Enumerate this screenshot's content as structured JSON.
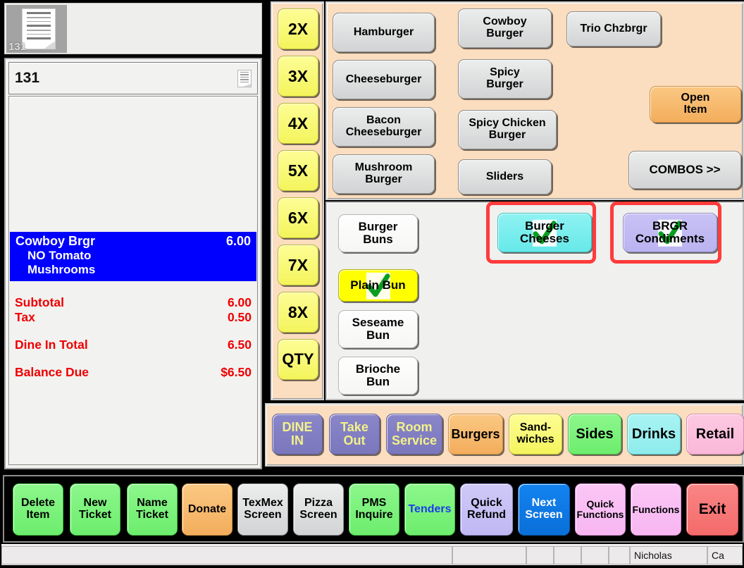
{
  "thumbnail": {
    "ticket_label": "131",
    "icon": "receipt-document-icon"
  },
  "ticket": {
    "number": "131",
    "icon": "receipt-document-icon",
    "line_items": [
      {
        "name": "Cowboy Brgr",
        "price": "6.00",
        "modifiers": [
          "NO Tomato",
          "Mushrooms"
        ]
      }
    ],
    "totals": [
      {
        "label": "Subtotal",
        "value": "6.00"
      },
      {
        "label": "Tax",
        "value": "0.50"
      },
      {
        "label": "Dine In Total",
        "value": "6.50"
      },
      {
        "label": "Balance Due",
        "value": "$6.50"
      }
    ]
  },
  "quantity_keys": [
    {
      "label": "2X"
    },
    {
      "label": "3X"
    },
    {
      "label": "4X"
    },
    {
      "label": "5X"
    },
    {
      "label": "6X"
    },
    {
      "label": "7X"
    },
    {
      "label": "8X"
    },
    {
      "label": "QTY"
    }
  ],
  "menu": {
    "column1": [
      {
        "label": "Hamburger"
      },
      {
        "label": "Cheeseburger"
      },
      {
        "label": "Bacon\nCheeseburger"
      },
      {
        "label": "Mushroom\nBurger"
      }
    ],
    "column2": [
      {
        "label": "Cowboy\nBurger"
      },
      {
        "label": "Spicy\nBurger"
      },
      {
        "label": "Spicy Chicken\nBurger"
      },
      {
        "label": "Sliders"
      }
    ],
    "column3": [
      {
        "label": "Trio Chzbrgr"
      }
    ],
    "open_item": {
      "label": "Open\nItem"
    },
    "combos": {
      "label": "COMBOS >>"
    }
  },
  "modifiers": {
    "buns": [
      {
        "label": "Burger\nBuns",
        "selected": false
      },
      {
        "label": "Plain Bun",
        "selected": true
      },
      {
        "label": "Seseame\nBun",
        "selected": false
      },
      {
        "label": "Brioche\nBun",
        "selected": false
      }
    ],
    "groups": [
      {
        "label": "Burger\nCheeses",
        "selected": true,
        "annotated": true
      },
      {
        "label": "BRGR\nCondiments",
        "selected": true,
        "annotated": true
      }
    ]
  },
  "categories": [
    {
      "label": "DINE\nIN"
    },
    {
      "label": "Take\nOut"
    },
    {
      "label": "Room\nService"
    },
    {
      "label": "Burgers"
    },
    {
      "label": "Sand-\nwiches"
    },
    {
      "label": "Sides"
    },
    {
      "label": "Drinks"
    },
    {
      "label": "Retail"
    }
  ],
  "functions": [
    {
      "label": "Delete\nItem"
    },
    {
      "label": "New\nTicket"
    },
    {
      "label": "Name\nTicket"
    },
    {
      "label": "Donate"
    },
    {
      "label": "TexMex\nScreen"
    },
    {
      "label": "Pizza\nScreen"
    },
    {
      "label": "PMS\nInquire"
    },
    {
      "label": "Tenders"
    },
    {
      "label": "Quick\nRefund"
    },
    {
      "label": "Next\nScreen"
    },
    {
      "label": "Quick\nFunctions"
    },
    {
      "label": "Functions"
    },
    {
      "label": "Exit"
    }
  ],
  "status_bar": {
    "cells": [
      "",
      "",
      "",
      "",
      "",
      "",
      "Nicholas",
      "Ca"
    ]
  },
  "colors": {
    "selected_line": "#0000ff",
    "totals_text": "#ee0000",
    "annotation": "#ff3b3b",
    "check": "#0a9e21",
    "panel_bg": "#fbddbf"
  }
}
